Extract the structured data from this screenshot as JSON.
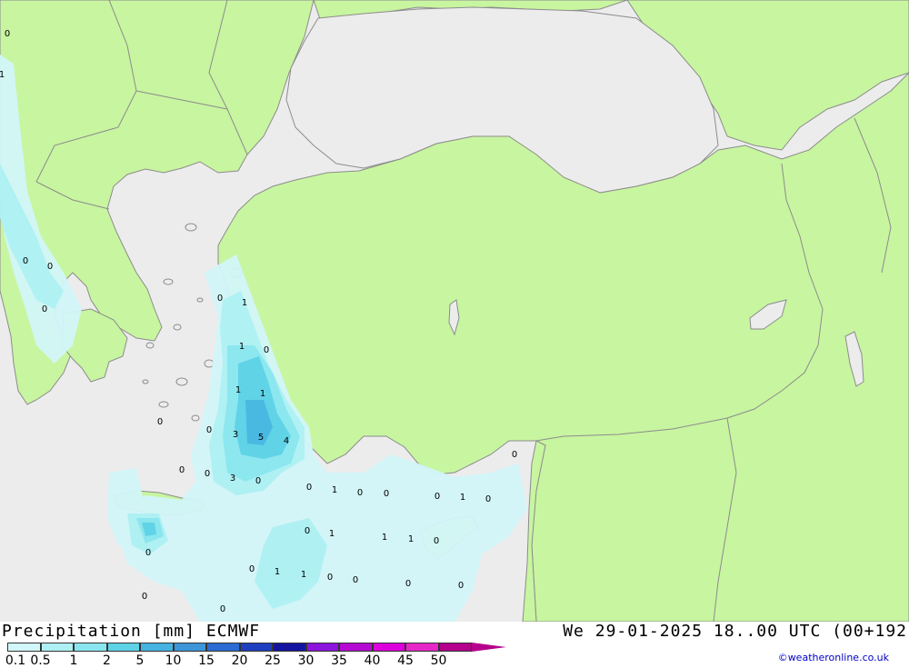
{
  "title": {
    "left": "Precipitation [mm] ECMWF",
    "right": "We 29-01-2025 18..00 UTC (00+192",
    "credit": "©weatheronline.co.uk"
  },
  "legend": {
    "labels": [
      "0.1",
      "0.5",
      "1",
      "2",
      "5",
      "10",
      "15",
      "20",
      "25",
      "30",
      "35",
      "40",
      "45",
      "50"
    ],
    "colors": [
      "#d2f6f9",
      "#aef0f3",
      "#8ae6ee",
      "#5ed2e6",
      "#46b4e0",
      "#3c96d8",
      "#2b6bd2",
      "#1e3fbe",
      "#1414a0",
      "#8c14dc",
      "#b40ad2",
      "#dc00dc",
      "#e628c8",
      "#b4008c"
    ]
  },
  "colors": {
    "sea": "#ececec",
    "land": "#c8f5a0",
    "border": "#8c8c8c"
  },
  "map_values": [
    "0",
    "1",
    "0",
    "0",
    "0",
    "0",
    "1",
    "1",
    "0",
    "1",
    "1",
    "0",
    "0",
    "3",
    "5",
    "4",
    "0",
    "0",
    "3",
    "0",
    "0",
    "0",
    "1",
    "0",
    "0",
    "0",
    "1",
    "0",
    "0",
    "1",
    "1",
    "1",
    "0",
    "0",
    "1",
    "1",
    "0",
    "0",
    "0",
    "0",
    "0",
    "0",
    "0"
  ]
}
